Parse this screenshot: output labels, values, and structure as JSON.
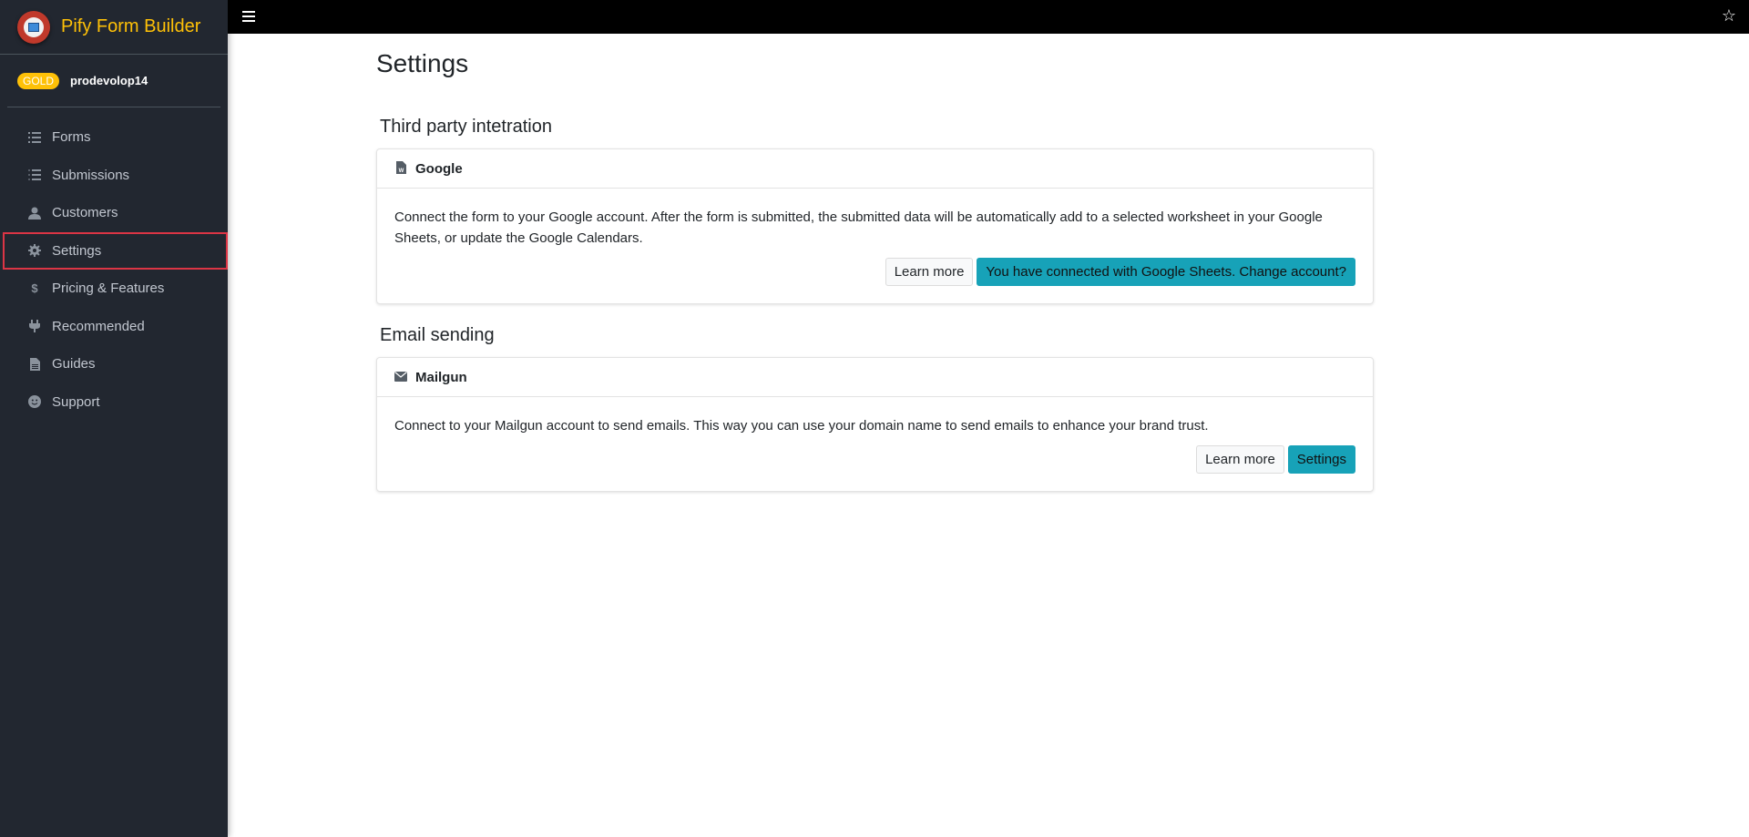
{
  "app": {
    "title": "Pify Form Builder"
  },
  "user": {
    "plan": "GOLD",
    "name": "prodevolop14"
  },
  "sidebar": {
    "items": [
      {
        "label": "Forms",
        "icon": "list-icon"
      },
      {
        "label": "Submissions",
        "icon": "checklist-icon"
      },
      {
        "label": "Customers",
        "icon": "user-icon"
      },
      {
        "label": "Settings",
        "icon": "gear-icon",
        "active": true
      },
      {
        "label": "Pricing & Features",
        "icon": "dollar-icon"
      },
      {
        "label": "Recommended",
        "icon": "plug-icon"
      },
      {
        "label": "Guides",
        "icon": "document-icon"
      },
      {
        "label": "Support",
        "icon": "smiley-icon"
      }
    ]
  },
  "page": {
    "title": "Settings"
  },
  "sections": {
    "integration": {
      "title": "Third party intetration",
      "card": {
        "title": "Google",
        "icon": "google-doc-icon",
        "description": "Connect the form to your Google account. After the form is submitted, the submitted data will be automatically add to a selected worksheet in your Google Sheets, or update the Google Calendars.",
        "learn_more": "Learn more",
        "action": "You have connected with Google Sheets. Change account?"
      }
    },
    "email": {
      "title": "Email sending",
      "card": {
        "title": "Mailgun",
        "icon": "envelope-icon",
        "description": "Connect to your Mailgun account to send emails. This way you can use your domain name to send emails to enhance your brand trust.",
        "learn_more": "Learn more",
        "action": "Settings"
      }
    }
  },
  "colors": {
    "sidebar_bg": "#222730",
    "brand": "#ffc107",
    "accent": "#17a2b8",
    "highlight": "#dc3545"
  }
}
